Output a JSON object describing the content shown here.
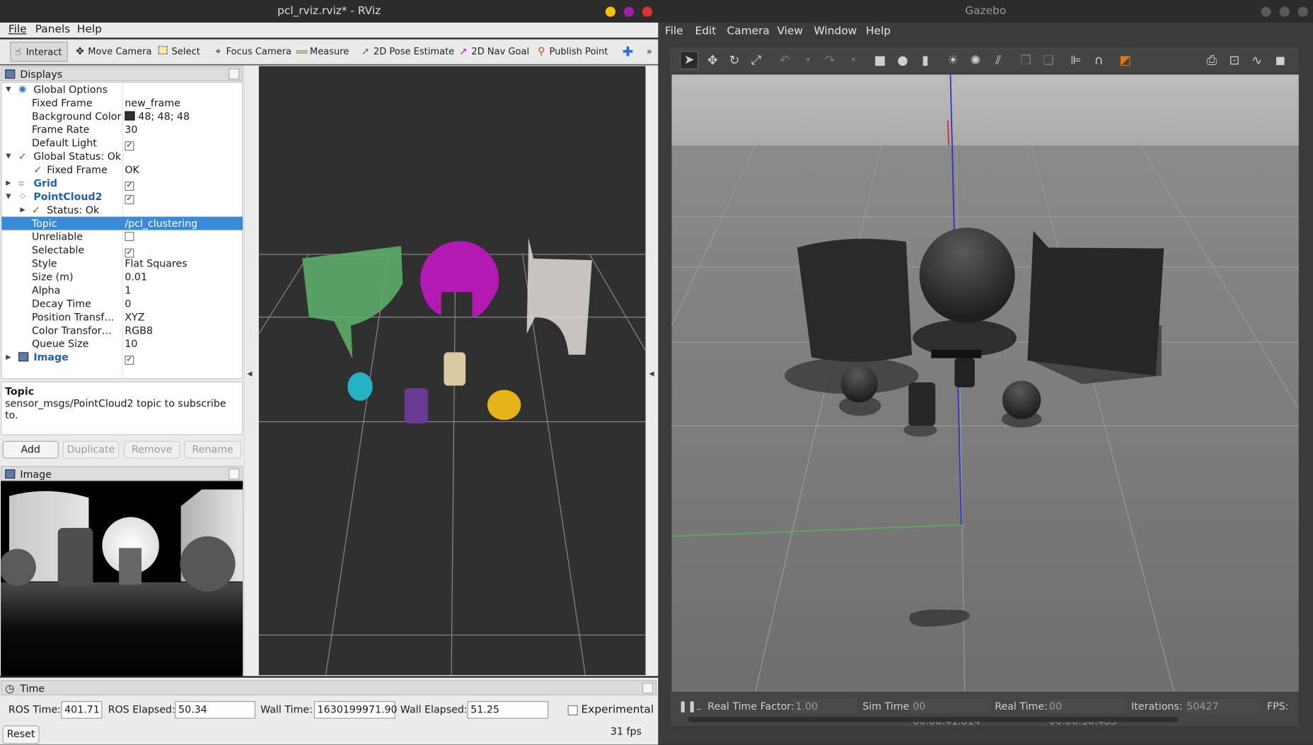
{
  "rviz": {
    "title": "pcl_rviz.rviz* - RViz",
    "menu": [
      "File",
      "Panels",
      "Help"
    ],
    "toolbar": {
      "interact": "Interact",
      "move_camera": "Move Camera",
      "select": "Select",
      "focus_camera": "Focus Camera",
      "measure": "Measure",
      "pose_estimate": "2D Pose Estimate",
      "nav_goal": "2D Nav Goal",
      "publish_point": "Publish Point",
      "more": "»"
    },
    "displays": {
      "title": "Displays",
      "global_options": "Global Options",
      "fixed_frame_k": "Fixed Frame",
      "fixed_frame_v": "new_frame",
      "bg_color_k": "Background Color",
      "bg_color_v": "48; 48; 48",
      "frame_rate_k": "Frame Rate",
      "frame_rate_v": "30",
      "default_light_k": "Default Light",
      "global_status": "Global Status: Ok",
      "gs_fixed_frame_k": "Fixed Frame",
      "gs_fixed_frame_v": "OK",
      "grid": "Grid",
      "pointcloud2": "PointCloud2",
      "status_ok": "Status: Ok",
      "topic_k": "Topic",
      "topic_v": "/pcl_clustering",
      "unreliable_k": "Unreliable",
      "selectable_k": "Selectable",
      "style_k": "Style",
      "style_v": "Flat Squares",
      "size_k": "Size (m)",
      "size_v": "0.01",
      "alpha_k": "Alpha",
      "alpha_v": "1",
      "decay_k": "Decay Time",
      "decay_v": "0",
      "pos_tf_k": "Position Transf…",
      "pos_tf_v": "XYZ",
      "color_tf_k": "Color Transfor…",
      "color_tf_v": "RGB8",
      "queue_k": "Queue Size",
      "queue_v": "10",
      "image": "Image"
    },
    "help": {
      "title": "Topic",
      "text": "sensor_msgs/PointCloud2 topic to subscribe to."
    },
    "buttons": {
      "add": "Add",
      "duplicate": "Duplicate",
      "remove": "Remove",
      "rename": "Rename"
    },
    "image_panel": {
      "title": "Image"
    },
    "time": {
      "title": "Time",
      "ros_time_l": "ROS Time:",
      "ros_time_v": "401.71",
      "ros_elapsed_l": "ROS Elapsed:",
      "ros_elapsed_v": "50.34",
      "wall_time_l": "Wall Time:",
      "wall_time_v": "1630199971.90",
      "wall_elapsed_l": "Wall Elapsed:",
      "wall_elapsed_v": "51.25",
      "experimental": "Experimental",
      "reset": "Reset",
      "fps": "31 fps"
    },
    "colors": {
      "accent": "#3a8bd6",
      "bg": "#303030",
      "green": "#5dae6c",
      "magenta": "#b21ab2",
      "white": "#d8d4d4",
      "cyan": "#27b1c4",
      "purple": "#6a3b94",
      "beige": "#d9caa3",
      "yellow": "#e6b318"
    }
  },
  "gazebo": {
    "title": "Gazebo",
    "menu": [
      "File",
      "Edit",
      "Camera",
      "View",
      "Window",
      "Help"
    ],
    "status": {
      "rtf_l": "Real Time Factor:",
      "rtf_v": "1.00",
      "sim_l": "Sim Time:",
      "sim_v": "00 00:06:41.614",
      "real_l": "Real Time:",
      "real_v": "00 00:00:50.483",
      "iter_l": "Iterations:",
      "iter_v": "50427",
      "fps_l": "FPS:"
    }
  }
}
